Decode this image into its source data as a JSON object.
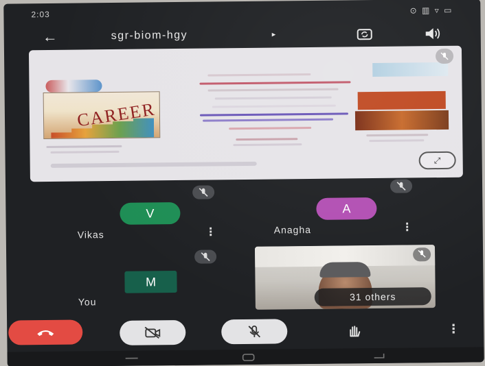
{
  "status_bar": {
    "time": "2:03",
    "left_extra": "⁂ ◦",
    "right_icons": "⊙ ▥ ▿ ▭"
  },
  "header": {
    "back_icon": "←",
    "meeting_code": "sgr-biom-hgy",
    "caret": "▸"
  },
  "screen_share": {
    "fullscreen_label": "⤢"
  },
  "participants": [
    {
      "initial": "V",
      "name": "Vikas",
      "color": "#1e8e55"
    },
    {
      "initial": "A",
      "name": "Anagha",
      "color": "#b24fb3"
    },
    {
      "initial": "M",
      "name": "You",
      "color": "#17604b"
    }
  ],
  "video_tile": {
    "others_label": "31 others"
  },
  "controls": {
    "end_call_color": "#e34b43",
    "more_icon": "⋮",
    "kebab_icon": "⋮"
  },
  "icons": [
    "back-arrow-icon",
    "switch-camera-icon",
    "speaker-icon",
    "mic-off-icon",
    "end-call-icon",
    "camera-off-icon",
    "mic-off-icon",
    "raise-hand-icon",
    "more-options-icon"
  ]
}
